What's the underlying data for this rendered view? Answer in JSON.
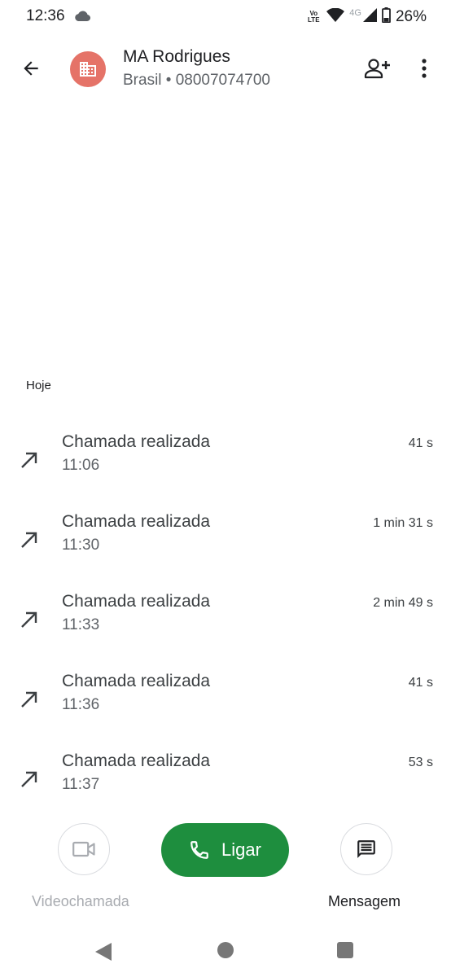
{
  "status_bar": {
    "time": "12:36",
    "volte_top": "Vo",
    "volte_bottom": "LTE",
    "network": "4G",
    "battery": "26%"
  },
  "contact": {
    "name": "MA Rodrigues",
    "subtitle": "Brasil • 08007074700",
    "avatar_color": "#e57368"
  },
  "history": {
    "section_label": "Hoje",
    "calls": [
      {
        "title": "Chamada realizada",
        "time": "11:06",
        "duration": "41 s"
      },
      {
        "title": "Chamada realizada",
        "time": "11:30",
        "duration": "1 min 31 s"
      },
      {
        "title": "Chamada realizada",
        "time": "11:33",
        "duration": "2 min 49 s"
      },
      {
        "title": "Chamada realizada",
        "time": "11:36",
        "duration": "41 s"
      },
      {
        "title": "Chamada realizada",
        "time": "11:37",
        "duration": "53 s"
      }
    ]
  },
  "actions": {
    "video_label": "Videochamada",
    "call_label": "Ligar",
    "message_label": "Mensagem",
    "call_color": "#1e8e3e"
  }
}
